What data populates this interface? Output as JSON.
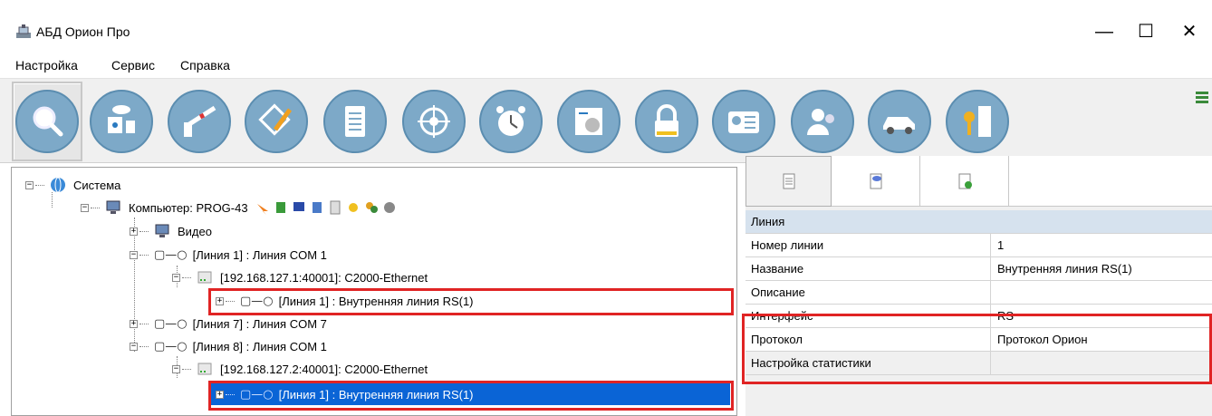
{
  "window": {
    "title": "АБД Орион Про",
    "controls": {
      "minimize": "—",
      "maximize": "☐",
      "close": "✕"
    }
  },
  "menu": [
    "Настройка",
    "Сервис",
    "Справка"
  ],
  "toolbar": {
    "buttons": [
      {
        "icon": "magnifier-icon"
      },
      {
        "icon": "camera-detector-icon"
      },
      {
        "icon": "barrier-icon"
      },
      {
        "icon": "pencil-plan-icon"
      },
      {
        "icon": "document-icon"
      },
      {
        "icon": "steering-wheel-icon"
      },
      {
        "icon": "alarm-clock-icon"
      },
      {
        "icon": "schedule-board-icon"
      },
      {
        "icon": "padlock-icon"
      },
      {
        "icon": "id-card-icon"
      },
      {
        "icon": "users-icon"
      },
      {
        "icon": "car-icon"
      },
      {
        "icon": "key-door-icon"
      }
    ],
    "active_index": 0
  },
  "tree": {
    "system": "Система",
    "computer": "Компьютер: PROG-43",
    "video": "Видео",
    "line1_com1": "[Линия 1] : Линия COM 1",
    "eth1": "[192.168.127.1:40001]: C2000-Ethernet",
    "line1_rs_a": "[Линия 1] : Внутренняя линия RS(1)",
    "line7": "[Линия 7] : Линия COM 7",
    "line8": "[Линия 8] : Линия COM 1",
    "eth2": "[192.168.127.2:40001]: C2000-Ethernet",
    "line1_rs_b": "[Линия 1] : Внутренняя линия RS(1)"
  },
  "properties": {
    "category": "Линия",
    "rows": [
      {
        "key": "Номер линии",
        "value": "1"
      },
      {
        "key": "Название",
        "value": "Внутренняя линия RS(1)"
      },
      {
        "key": "Описание",
        "value": ""
      },
      {
        "key": "Интерфейс",
        "value": "RS"
      },
      {
        "key": "Протокол",
        "value": "Протокол Орион"
      },
      {
        "key": "Настройка статистики",
        "value": ""
      }
    ]
  },
  "colors": {
    "selection": "#0a64d6",
    "highlight": "#e02424",
    "toolbar_circle": "#7da9c8",
    "category_row": "#d6e2ee"
  }
}
